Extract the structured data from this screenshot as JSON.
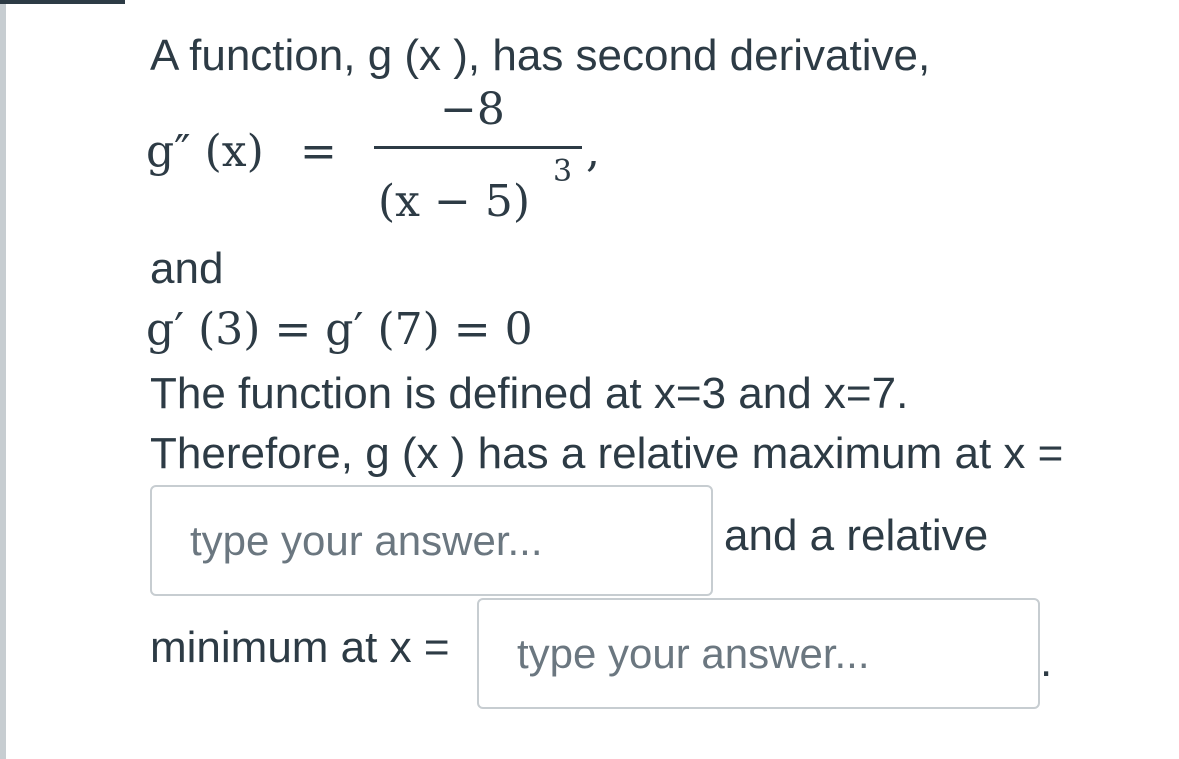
{
  "question": {
    "intro": "A function, g (x ), has second derivative,",
    "formula1": {
      "lhs": "g″ (x)",
      "equals": "=",
      "numerator": "−8",
      "denominator": "(x − 5)",
      "exponent": "3",
      "comma": ","
    },
    "and_label": "and",
    "formula2": "g′ (3) = g′ (7) = 0",
    "statement": "The function is defined at x=3 and x=7.",
    "max_prompt": "Therefore, g (x ) has a relative maximum at x =",
    "mid_text": "and a relative",
    "min_prompt": "minimum at x =",
    "end_punct": "."
  },
  "answers": {
    "max": {
      "placeholder": "type your answer...",
      "value": ""
    },
    "min": {
      "placeholder": "type your answer...",
      "value": ""
    }
  }
}
